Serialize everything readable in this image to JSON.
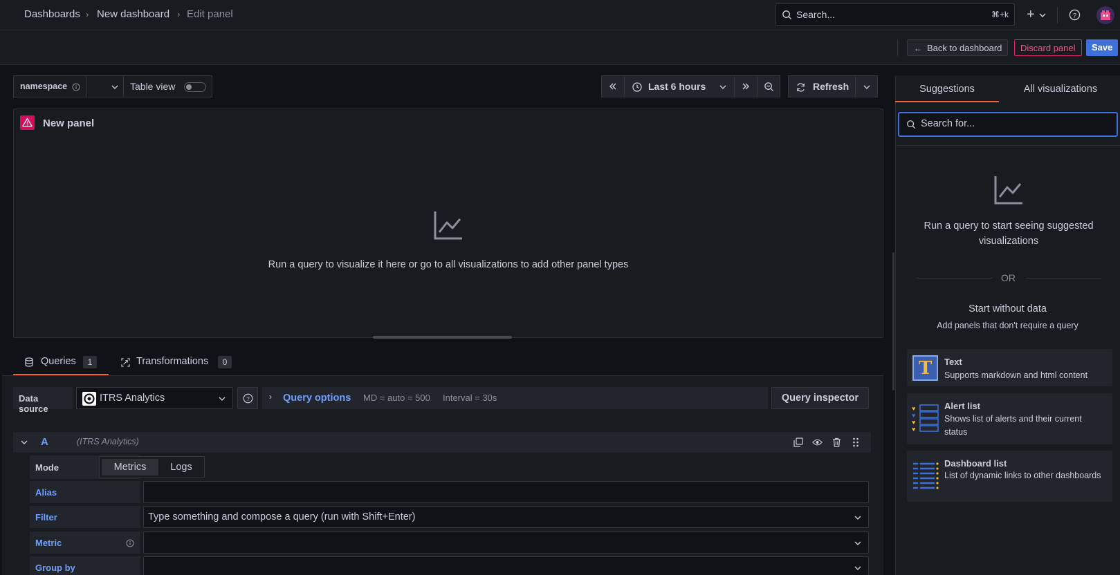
{
  "breadcrumb": {
    "items": [
      "Dashboards",
      "New dashboard",
      "Edit panel"
    ]
  },
  "topbar": {
    "search_placeholder": "Search...",
    "search_shortcut": "⌘+k",
    "add_label": "+"
  },
  "editbar": {
    "back_label": "Back to dashboard",
    "discard_label": "Discard panel",
    "save_label": "Save"
  },
  "toolbar": {
    "variable_label": "namespace",
    "table_view_label": "Table view",
    "time_range": "Last 6 hours",
    "refresh_label": "Refresh"
  },
  "panel": {
    "title": "New panel",
    "empty_message": "Run a query to visualize it here or go to all visualizations to add other panel types"
  },
  "query_tabs": [
    {
      "label": "Queries",
      "count": "1"
    },
    {
      "label": "Transformations",
      "count": "0"
    }
  ],
  "datasource": {
    "label": "Data source",
    "value": "ITRS Analytics",
    "query_options_label": "Query options",
    "md": "MD = auto = 500",
    "interval": "Interval = 30s",
    "inspector_label": "Query inspector"
  },
  "query": {
    "ref_id": "A",
    "datasource_name": "(ITRS Analytics)",
    "mode_label": "Mode",
    "modes": [
      "Metrics",
      "Logs"
    ],
    "alias_label": "Alias",
    "filter_label": "Filter",
    "filter_placeholder": "Type something and compose a query (run with Shift+Enter)",
    "metric_label": "Metric",
    "group_by_label": "Group by"
  },
  "viz_pane": {
    "tabs": [
      "Suggestions",
      "All visualizations"
    ],
    "search_placeholder": "Search for...",
    "suggest_message": "Run a query to start seeing suggested visualizations",
    "or_label": "OR",
    "start_title": "Start without data",
    "start_sub": "Add panels that don't require a query",
    "cards": [
      {
        "title": "Text",
        "desc": "Supports markdown and html content"
      },
      {
        "title": "Alert list",
        "desc": "Shows list of alerts and their current status"
      },
      {
        "title": "Dashboard list",
        "desc": "List of dynamic links to other dashboards"
      }
    ]
  },
  "colors": {
    "accent": "#3d71d9",
    "danger": "#e0226e",
    "blue_text": "#6e9fff",
    "orange": "#f5b73d"
  }
}
